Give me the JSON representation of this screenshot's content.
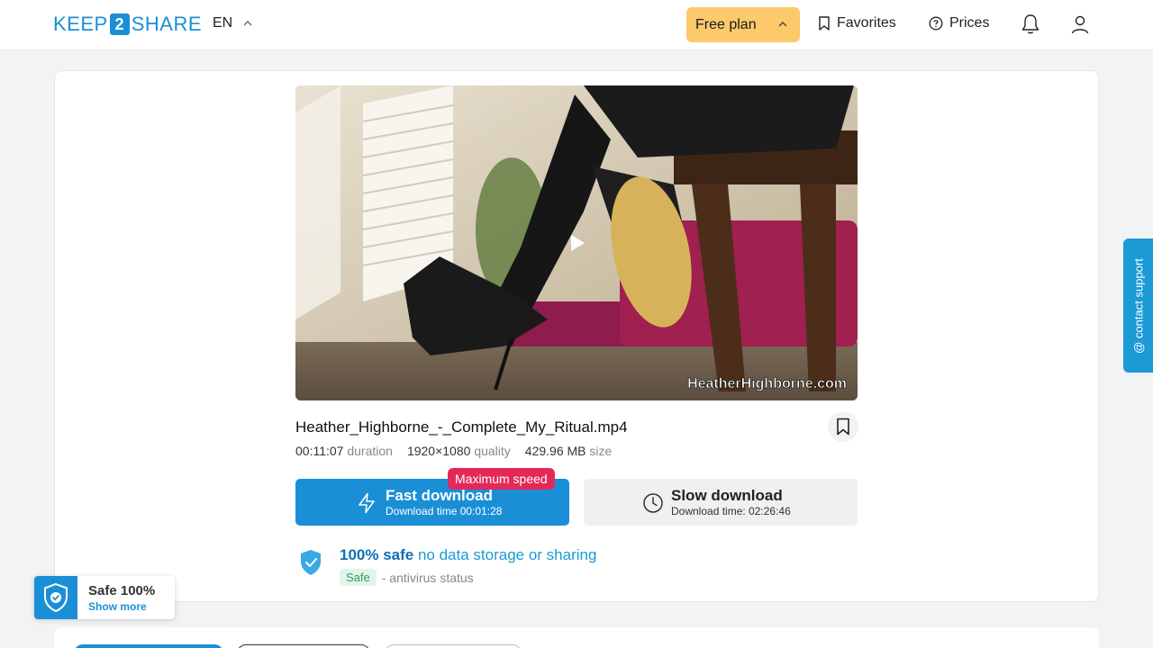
{
  "header": {
    "logo_left": "KEEP",
    "logo_mid": "2",
    "logo_right": "SHARE",
    "language": "EN",
    "plan_label": "Free plan",
    "favorites_label": "Favorites",
    "prices_label": "Prices"
  },
  "video": {
    "watermark": "HeatherHighborne.com"
  },
  "file": {
    "name": "Heather_Highborne_-_Complete_My_Ritual.mp4",
    "duration": "00:11:07",
    "duration_label": "duration",
    "quality": "1920×1080",
    "quality_label": "quality",
    "size": "429.96 MB",
    "size_label": "size"
  },
  "download": {
    "fast_title": "Fast download",
    "fast_sub": "Download time 00:01:28",
    "badge": "Maximum speed",
    "slow_title": "Slow download",
    "slow_sub": "Download time: 02:26:46"
  },
  "safety": {
    "bold": "100% safe",
    "rest": "no data storage or sharing",
    "badge": "Safe",
    "status": "- antivirus status"
  },
  "contact_label": "@ contact support",
  "widget": {
    "title": "Safe 100%",
    "link": "Show more"
  },
  "colors": {
    "brand": "#1b8fd6",
    "plan": "#fcc96b",
    "badge": "#e5285a"
  }
}
